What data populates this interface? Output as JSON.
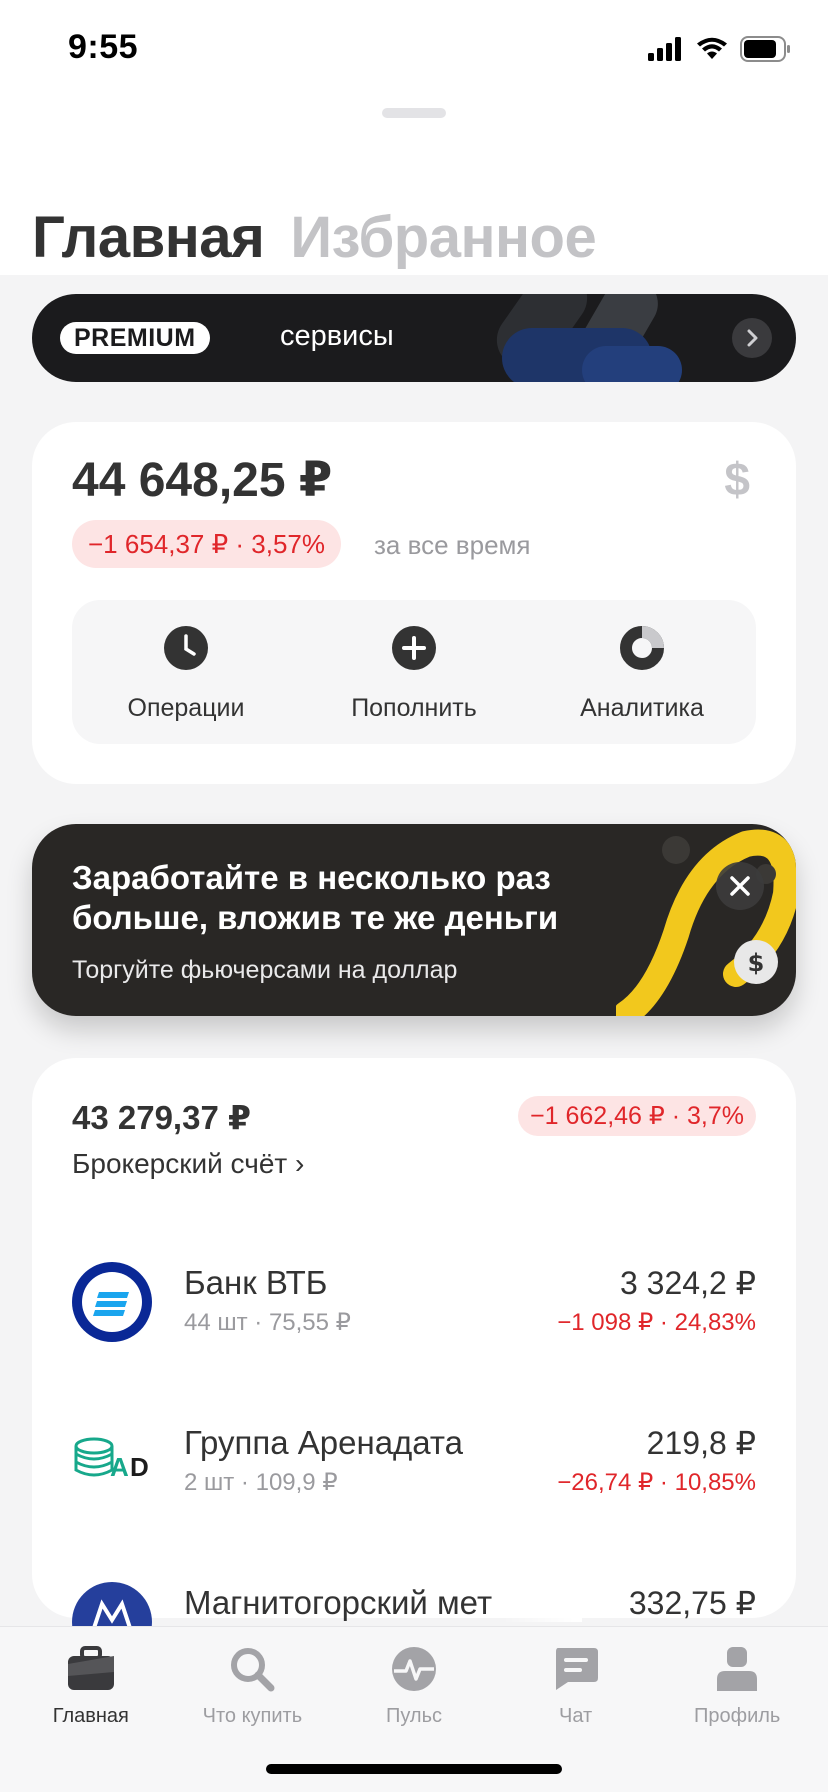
{
  "status_bar": {
    "time": "9:55"
  },
  "top_tabs": {
    "active": "Главная",
    "inactive": "Избранное"
  },
  "premium_banner": {
    "badge": "PREMIUM",
    "text": "сервисы"
  },
  "balance": {
    "amount": "44 648,25 ₽",
    "currency_symbol": "$",
    "change": "−1 654,37 ₽ · 3,57%",
    "period": "за все время"
  },
  "actions": [
    {
      "label": "Операции",
      "icon": "clock-icon"
    },
    {
      "label": "Пополнить",
      "icon": "plus-icon"
    },
    {
      "label": "Аналитика",
      "icon": "donut-chart-icon"
    }
  ],
  "promo": {
    "title": "Заработайте в несколько раз больше, вложив те же деньги",
    "subtitle": "Торгуйте фьючерсами на доллар"
  },
  "account": {
    "value": "43 279,37 ₽",
    "change": "−1 662,46 ₽ · 3,7%",
    "name": "Брокерский счёт ›"
  },
  "holdings": [
    {
      "name": "Банк ВТБ",
      "detail": "44 шт · 75,55 ₽",
      "value": "3 324,2 ₽",
      "change": "−1 098 ₽ · 24,83%",
      "logo": "vtb-logo"
    },
    {
      "name": "Группа Аренадата",
      "detail": "2 шт · 109,9 ₽",
      "value": "219,8 ₽",
      "change": "−26,74 ₽ · 10,85%",
      "logo": "arenadata-logo"
    },
    {
      "name": "Магнитогорский мет",
      "detail": "",
      "value": "332,75 ₽",
      "change": "",
      "logo": "mmk-logo"
    }
  ],
  "tabbar": [
    {
      "label": "Главная",
      "icon": "briefcase-icon",
      "active": true
    },
    {
      "label": "Что купить",
      "icon": "search-icon",
      "active": false
    },
    {
      "label": "Пульс",
      "icon": "pulse-icon",
      "active": false
    },
    {
      "label": "Чат",
      "icon": "chat-icon",
      "active": false
    },
    {
      "label": "Профиль",
      "icon": "profile-icon",
      "active": false
    }
  ],
  "colors": {
    "negative": "#e0262a",
    "negative_bg": "#fde4e4",
    "promo_accent": "#f2c81d",
    "vtb_blue": "#0a2896"
  }
}
